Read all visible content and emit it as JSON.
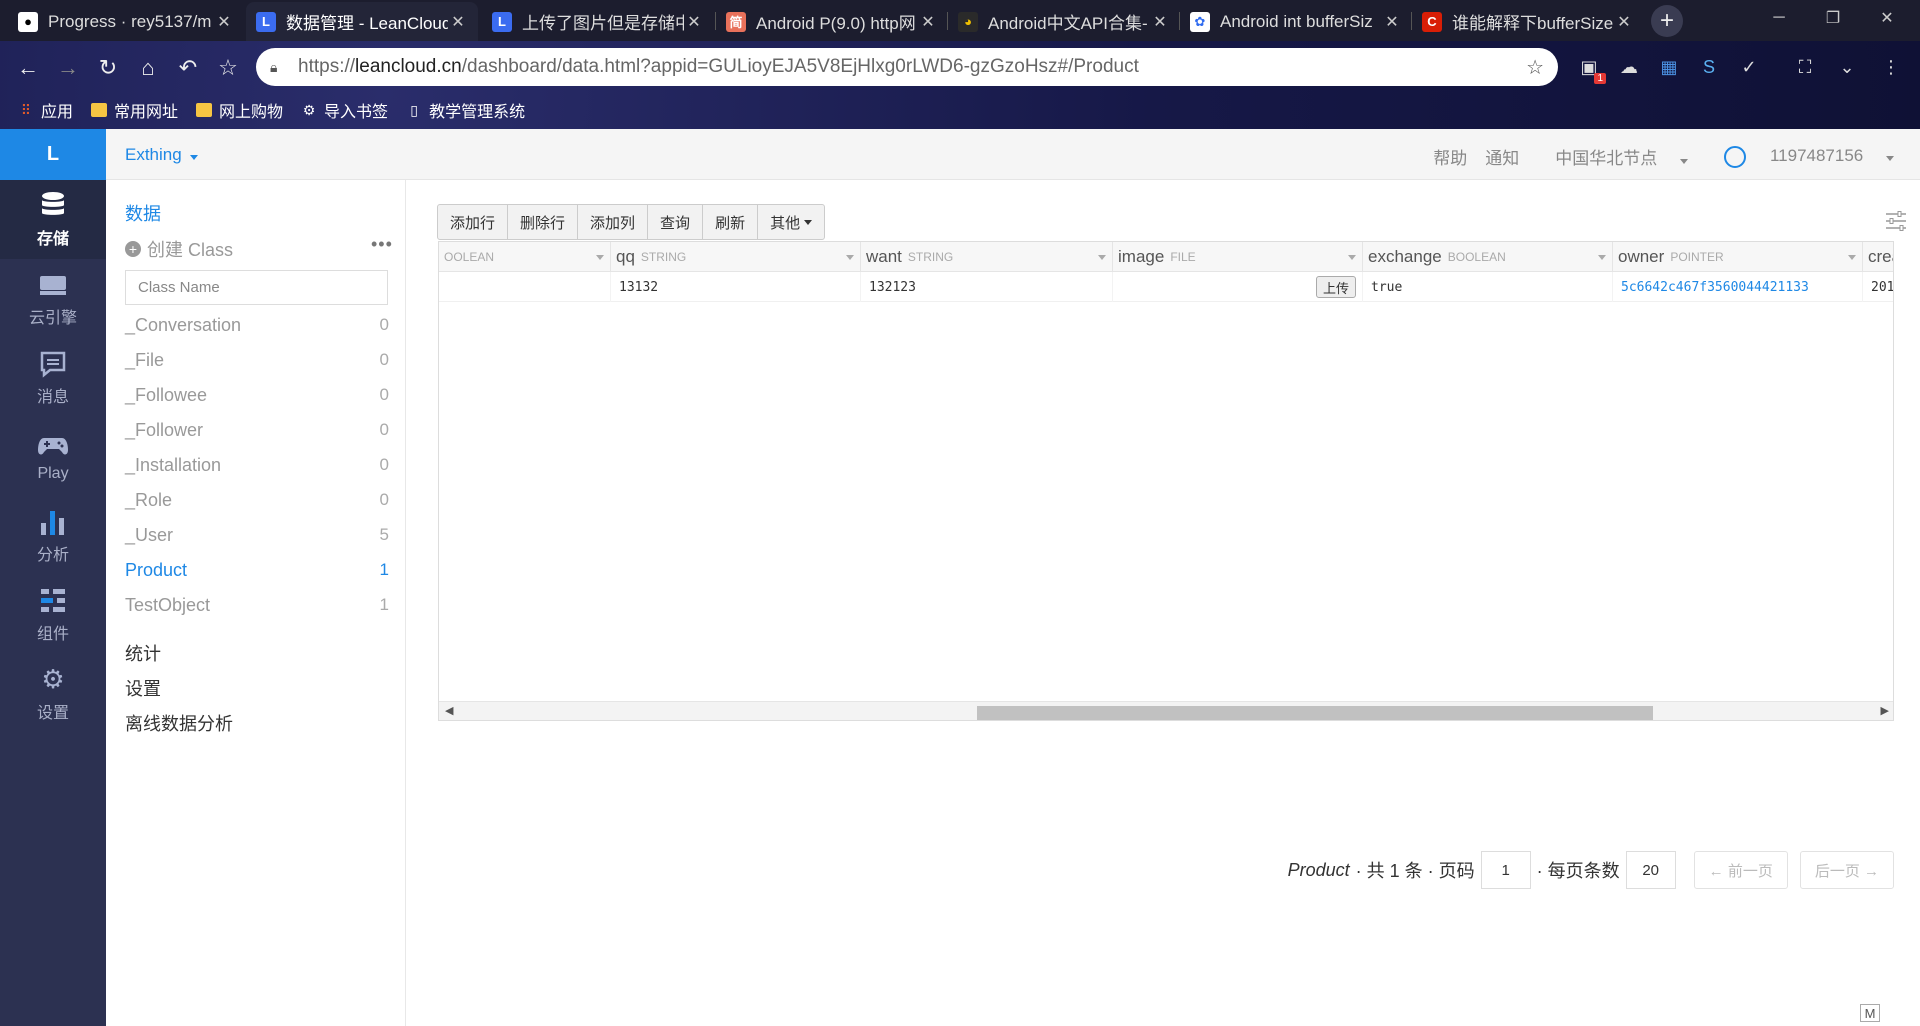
{
  "browser": {
    "tabs": [
      {
        "title": "Progress · rey5137/m",
        "icon": "github-icon",
        "color": "#333333"
      },
      {
        "title": "数据管理 - LeanCloud",
        "icon": "leancloud-icon",
        "color": "#3b6cf0"
      },
      {
        "title": "上传了图片但是存储中",
        "icon": "leancloud-icon",
        "color": "#3b6cf0"
      },
      {
        "title": "Android P(9.0) http网",
        "icon": "jianshu-icon",
        "color": "#e8715b"
      },
      {
        "title": "Android中文API合集-",
        "icon": "penguin-icon",
        "color": "#f0c000"
      },
      {
        "title": "Android int bufferSiz",
        "icon": "baidu-icon",
        "color": "#2f6bf0"
      },
      {
        "title": "谁能解释下bufferSize",
        "icon": "csdn-icon",
        "color": "#d81e06"
      }
    ],
    "address": {
      "scheme": "https://",
      "host": "leancloud.cn",
      "path": "/dashboard/data.html?appid=GULioyEJA5V8EjHlxg0rLWD6-gzGzoHsz#/Product"
    },
    "bookmarks": [
      "应用",
      "常用网址",
      "网上购物",
      "导入书签",
      "教学管理系统"
    ],
    "extension_badge": "1"
  },
  "app": {
    "logo": "L",
    "name": "Exthing",
    "rail": [
      {
        "label": "存储",
        "icon": "database-icon",
        "active": true
      },
      {
        "label": "云引擎",
        "icon": "cloud-engine-icon",
        "active": false
      },
      {
        "label": "消息",
        "icon": "message-icon",
        "active": false
      },
      {
        "label": "Play",
        "icon": "gamepad-icon",
        "active": false
      },
      {
        "label": "分析",
        "icon": "bar-chart-icon",
        "active": false
      },
      {
        "label": "组件",
        "icon": "components-icon",
        "active": false
      },
      {
        "label": "设置",
        "icon": "gear-icon",
        "active": false
      }
    ],
    "topnav": {
      "help": "帮助",
      "notify": "通知",
      "region": "中国华北节点",
      "user": "1197487156"
    }
  },
  "sidebar": {
    "section_data": "数据",
    "create_class": "创建 Class",
    "more": "•••",
    "class_input_placeholder": "Class Name",
    "classes": [
      {
        "name": "_Conversation",
        "count": "0"
      },
      {
        "name": "_File",
        "count": "0"
      },
      {
        "name": "_Followee",
        "count": "0"
      },
      {
        "name": "_Follower",
        "count": "0"
      },
      {
        "name": "_Installation",
        "count": "0"
      },
      {
        "name": "_Role",
        "count": "0"
      },
      {
        "name": "_User",
        "count": "5"
      },
      {
        "name": "Product",
        "count": "1",
        "active": true
      },
      {
        "name": "TestObject",
        "count": "1"
      }
    ],
    "links": [
      "统计",
      "设置",
      "离线数据分析"
    ]
  },
  "main": {
    "buttons": [
      "添加行",
      "删除行",
      "添加列",
      "查询",
      "刷新",
      "其他"
    ],
    "columns": [
      {
        "name": "",
        "type": "OOLEAN"
      },
      {
        "name": "qq",
        "type": "STRING"
      },
      {
        "name": "want",
        "type": "STRING"
      },
      {
        "name": "image",
        "type": "FILE"
      },
      {
        "name": "exchange",
        "type": "BOOLEAN"
      },
      {
        "name": "owner",
        "type": "POINTER"
      },
      {
        "name": "crea",
        "type": ""
      }
    ],
    "rows": [
      {
        "c0": "",
        "qq": "13132",
        "want": "132123",
        "image_button": "上传",
        "exchange": "true",
        "owner": "5c6642c467f3560044421133",
        "created": "201"
      }
    ],
    "pager": {
      "class_name": "Product",
      "total": "· 共 1 条 · 页码",
      "page": "1",
      "per_page_label": "· 每页条数",
      "per_page": "20",
      "prev": "← 前一页",
      "next": "后一页 →"
    },
    "corner_badge": "M"
  }
}
